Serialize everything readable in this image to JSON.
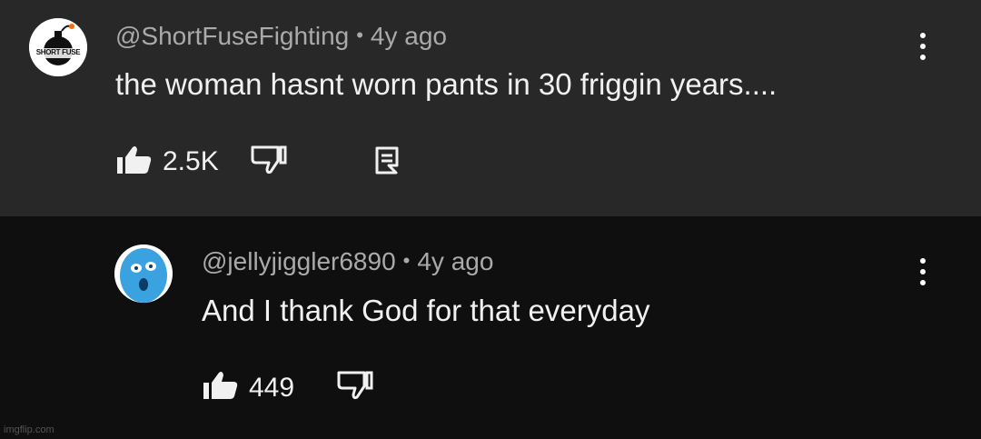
{
  "comments": [
    {
      "handle": "@ShortFuseFighting",
      "separator": "•",
      "time": "4y ago",
      "text": "the woman hasnt worn pants in 30 friggin years....",
      "likes": "2.5K",
      "avatar_label": "SHORT FUSE",
      "icons": [
        "like-icon",
        "dislike-icon",
        "reply-icon",
        "more-options-icon"
      ]
    },
    {
      "handle": "@jellyjiggler6890",
      "separator": "•",
      "time": "4y ago",
      "text": "And I thank God for that everyday",
      "likes": "449",
      "icons": [
        "like-icon",
        "dislike-icon",
        "more-options-icon"
      ]
    }
  ],
  "watermark": "imgflip.com",
  "colors": {
    "top_bg": "#282828",
    "bottom_bg": "#0f0f0f",
    "meta_text": "#aaaaaa",
    "body_text": "#f1f1f1",
    "avatar2_blue": "#3aa2df"
  }
}
